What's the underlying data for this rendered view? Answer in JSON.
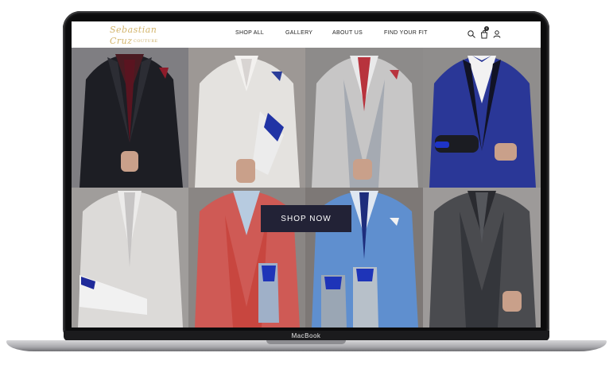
{
  "device": {
    "brand_label": "MacBook"
  },
  "site": {
    "logo": {
      "script": "Sebastian Cruz",
      "sub": "COUTURE"
    },
    "nav": [
      {
        "label": "SHOP ALL"
      },
      {
        "label": "GALLERY"
      },
      {
        "label": "ABOUT US"
      },
      {
        "label": "FIND YOUR FIT"
      }
    ],
    "cart_count": "0",
    "hero_button": "SHOP NOW"
  },
  "colors": {
    "logo_gold": "#d3b56c",
    "button_navy": "#222236",
    "header_bg": "#ffffff"
  },
  "icons": [
    "search-icon",
    "cart-icon",
    "account-icon"
  ],
  "gallery": [
    {
      "name": "black-paisley-tuxedo"
    },
    {
      "name": "white-shawl-lapel-tuxedo-blue-loafer"
    },
    {
      "name": "silver-paisley-suit-red-tie"
    },
    {
      "name": "royal-blue-floral-tuxedo-loafers"
    },
    {
      "name": "white-textured-suit-white-loafer"
    },
    {
      "name": "red-linen-suit-blue-shoes"
    },
    {
      "name": "light-blue-suit-oxford-shoes"
    },
    {
      "name": "charcoal-tweed-three-piece-suit"
    }
  ]
}
